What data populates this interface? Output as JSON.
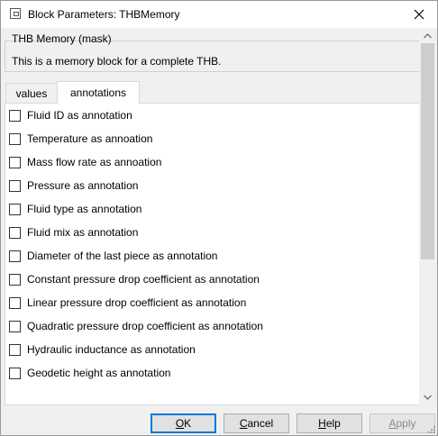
{
  "window": {
    "title": "Block Parameters: THBMemory"
  },
  "mask": {
    "group_label": "THB Memory (mask)",
    "description": "This is a memory block for a complete THB."
  },
  "tabs": [
    {
      "label": "values",
      "active": false
    },
    {
      "label": "annotations",
      "active": true
    }
  ],
  "options": [
    {
      "label": "Fluid ID as annotation",
      "checked": false
    },
    {
      "label": "Temperature as annoation",
      "checked": false
    },
    {
      "label": "Mass flow rate as annoation",
      "checked": false
    },
    {
      "label": "Pressure as annotation",
      "checked": false
    },
    {
      "label": "Fluid type as annotation",
      "checked": false
    },
    {
      "label": "Fluid mix as annotation",
      "checked": false
    },
    {
      "label": "Diameter of the last piece as annotation",
      "checked": false
    },
    {
      "label": "Constant pressure drop coefficient as annotation",
      "checked": false
    },
    {
      "label": "Linear pressure drop coefficient as annotation",
      "checked": false
    },
    {
      "label": "Quadratic pressure drop coefficient as annotation",
      "checked": false
    },
    {
      "label": "Hydraulic inductance as annotation",
      "checked": false
    },
    {
      "label": "Geodetic height as annotation",
      "checked": false
    }
  ],
  "buttons": {
    "ok": {
      "first": "O",
      "rest": "K"
    },
    "cancel": {
      "first": "C",
      "rest": "ancel"
    },
    "help": {
      "first": "H",
      "rest": "elp"
    },
    "apply": {
      "first": "A",
      "rest": "pply",
      "disabled": true
    }
  },
  "colors": {
    "accent": "#0078d7",
    "background": "#f0f0f0",
    "panel": "#ffffff"
  }
}
